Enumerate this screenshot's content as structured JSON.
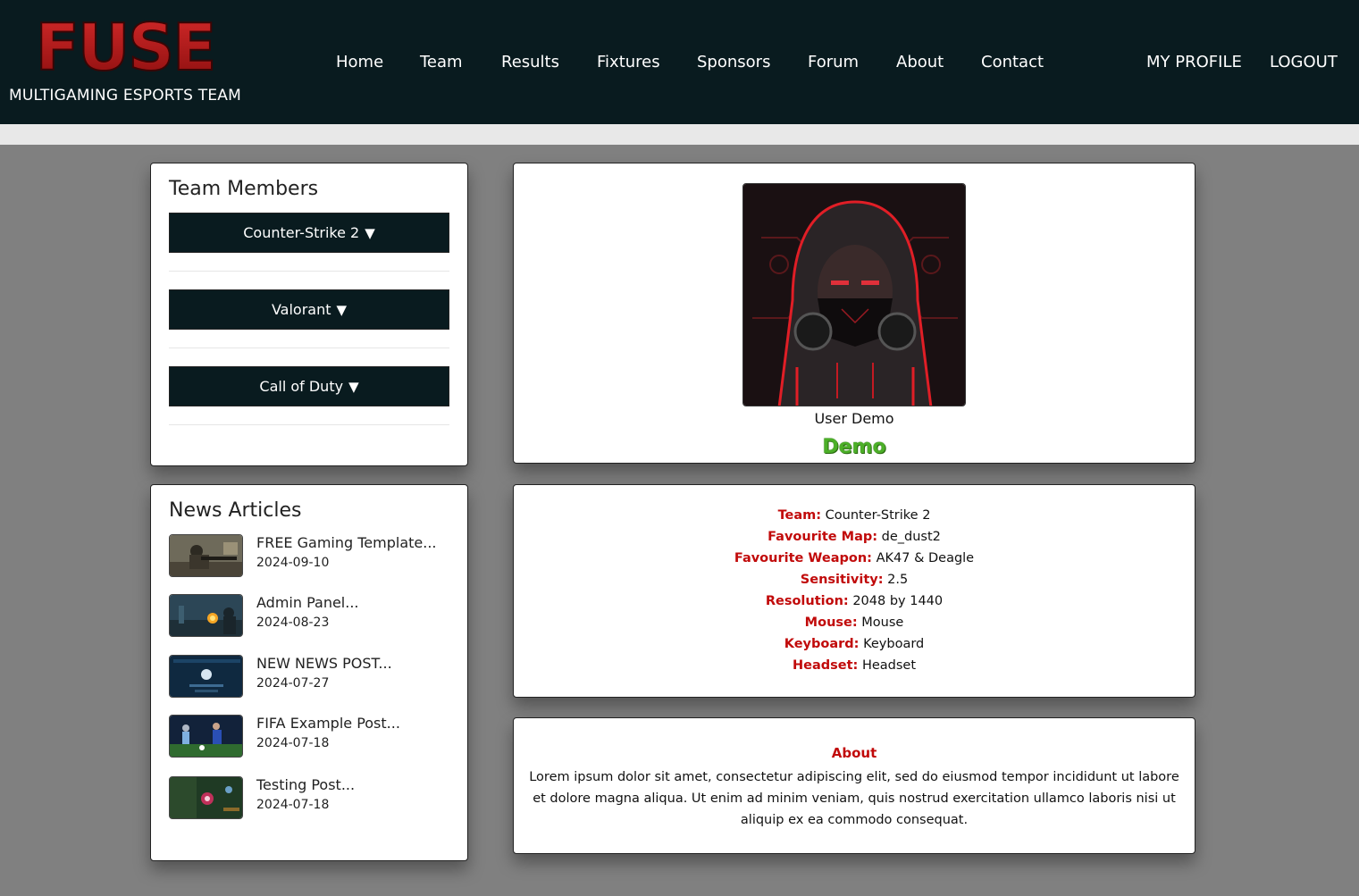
{
  "brand": {
    "logo_text": "FUSE",
    "tagline": "MULTIGAMING ESPORTS TEAM"
  },
  "nav": {
    "items": [
      "Home",
      "Team",
      "Results",
      "Fixtures",
      "Sponsors",
      "Forum",
      "About",
      "Contact"
    ],
    "profile": "MY PROFILE",
    "logout": "LOGOUT"
  },
  "team_members": {
    "title": "Team Members",
    "games": [
      {
        "label": "Counter-Strike 2",
        "arrow": "▼"
      },
      {
        "label": "Valorant",
        "arrow": "▼"
      },
      {
        "label": "Call of Duty",
        "arrow": "▼"
      }
    ]
  },
  "news": {
    "title": "News Articles",
    "items": [
      {
        "title": "FREE Gaming Template...",
        "date": "2024-09-10",
        "thumb": "soldier-thumbnail"
      },
      {
        "title": "Admin Panel...",
        "date": "2024-08-23",
        "thumb": "battle-thumbnail"
      },
      {
        "title": "NEW NEWS POST...",
        "date": "2024-07-27",
        "thumb": "interface-thumbnail"
      },
      {
        "title": "FIFA Example Post...",
        "date": "2024-07-18",
        "thumb": "football-thumbnail"
      },
      {
        "title": "Testing Post...",
        "date": "2024-07-18",
        "thumb": "moba-thumbnail"
      }
    ]
  },
  "profile": {
    "username": "User Demo",
    "rank": "Demo",
    "avatar": "hooded-gamer-avatar"
  },
  "stats": [
    {
      "label": "Team:",
      "value": "Counter-Strike 2"
    },
    {
      "label": "Favourite Map:",
      "value": "de_dust2"
    },
    {
      "label": "Favourite Weapon:",
      "value": "AK47 & Deagle"
    },
    {
      "label": "Sensitivity:",
      "value": "2.5"
    },
    {
      "label": "Resolution:",
      "value": "2048 by 1440"
    },
    {
      "label": "Mouse:",
      "value": "Mouse"
    },
    {
      "label": "Keyboard:",
      "value": "Keyboard"
    },
    {
      "label": "Headset:",
      "value": "Headset"
    }
  ],
  "about": {
    "title": "About",
    "text": "Lorem ipsum dolor sit amet, consectetur adipiscing elit, sed do eiusmod tempor incididunt ut labore et dolore magna aliqua. Ut enim ad minim veniam, quis nostrud exercitation ullamco laboris nisi ut aliquip ex ea commodo consequat."
  },
  "colors": {
    "header_bg": "#091b1f",
    "page_bg": "#808080",
    "accent_red": "#c10a0a",
    "rank_green": "#4caf28"
  }
}
